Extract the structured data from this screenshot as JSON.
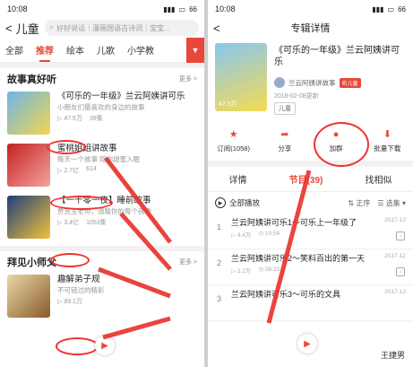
{
  "left": {
    "status": {
      "time": "10:08",
      "battery": "66"
    },
    "header": {
      "back": "<",
      "title": "儿童",
      "search_placeholder": "好好说话｜漫画国语古诗词｜宝宝..."
    },
    "tabs": [
      {
        "label": "全部",
        "active": false
      },
      {
        "label": "推荐",
        "active": true
      },
      {
        "label": "绘本",
        "active": false
      },
      {
        "label": "儿歌",
        "active": false
      },
      {
        "label": "小学教",
        "active": false
      }
    ],
    "section1": {
      "title": "故事真好听",
      "more": "更多 >"
    },
    "items": [
      {
        "title": "《可乐的一年级》兰云阿姨讲可乐",
        "subtitle": "小朋友们最喜欢的身边的故事",
        "plays": "47.5万",
        "count": "39集"
      },
      {
        "title": "蜜桃姐姐讲故事",
        "subtitle": "每天一个故事 陪你甜蜜入眠",
        "plays": "2.7亿",
        "count": "614"
      },
      {
        "title": "【一千零一夜】睡前故事",
        "subtitle": "贾克玉老师，温暖你的每个夜晚",
        "plays": "3.4亿",
        "count": "1053集"
      }
    ],
    "section2": {
      "title": "拜见小师父",
      "more": "更多 >"
    },
    "item4": {
      "title": "趣解弟子规",
      "subtitle": "不可错过的精彩",
      "plays": "89.1万"
    }
  },
  "right": {
    "status": {
      "time": "10:08",
      "battery": "66"
    },
    "header": {
      "back": "<",
      "title": "专辑详情"
    },
    "album": {
      "title": "《可乐的一年级》兰云阿姨讲可乐",
      "anchor": "兰云阿姨讲故事",
      "badge": "听儿童",
      "date": "2018-02-08更新",
      "tag": "儿童",
      "cover_text": "47.5万"
    },
    "actions": [
      {
        "label": "订阅(1058)",
        "icon": "star-icon"
      },
      {
        "label": "分享",
        "icon": "share-icon"
      },
      {
        "label": "加群",
        "icon": "group-icon"
      },
      {
        "label": "批量下载",
        "icon": "download-icon"
      }
    ],
    "tabs": [
      {
        "label": "详情",
        "active": false
      },
      {
        "label": "节目(39)",
        "active": true
      },
      {
        "label": "找相似",
        "active": false
      }
    ],
    "controls": {
      "play_all": "全部播放",
      "sort": "正序",
      "select": "选集"
    },
    "tracks": [
      {
        "num": "1",
        "title": "兰云阿姨讲可乐1～可乐上一年级了",
        "plays": "4.4万",
        "duration": "10:54",
        "date": "2017-12"
      },
      {
        "num": "2",
        "title": "兰云阿姨讲可乐2～笑料百出的第一天",
        "plays": "2.2万",
        "duration": "08:33",
        "date": "2017-12"
      },
      {
        "num": "3",
        "title": "兰云阿姨讲可乐3～可乐的文具",
        "plays": "",
        "duration": "",
        "date": "2017-12"
      }
    ],
    "watermark": "王捷男"
  }
}
